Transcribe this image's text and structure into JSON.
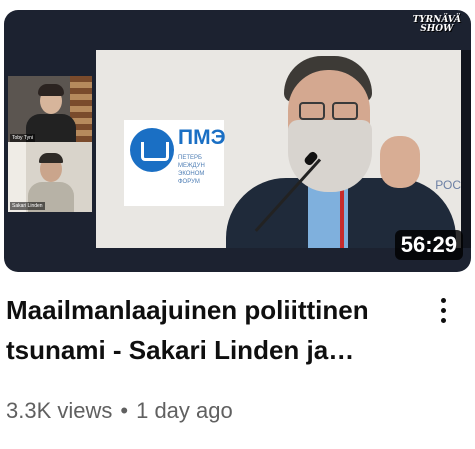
{
  "video": {
    "title_line1": "Maailmanlaajuinen poliittinen",
    "title_line2": "tsunami - Sakari Linden ja…",
    "duration": "56:29",
    "views": "3.3K views",
    "separator": "•",
    "age": "1 day ago"
  },
  "thumbnail": {
    "channel_logo_line1": "TYRNÄVÄ",
    "channel_logo_line2": "SHOW",
    "participant1_name": "Toby Tyni",
    "participant2_name": "Sakari Linden",
    "stage_sign_big": "ПМЭ",
    "stage_sign_small": [
      "ПЕТЕРБ",
      "МЕЖДУН",
      "ЭКОНОМ",
      "ФОРУМ"
    ],
    "stage_sign_right": "РОС"
  },
  "colors": {
    "title": "#0f0f0f",
    "meta": "#606060",
    "duration_bg": "#000000",
    "forum_blue": "#1a6fc4"
  },
  "icons": {
    "more": "three-vertical-dots-icon"
  }
}
